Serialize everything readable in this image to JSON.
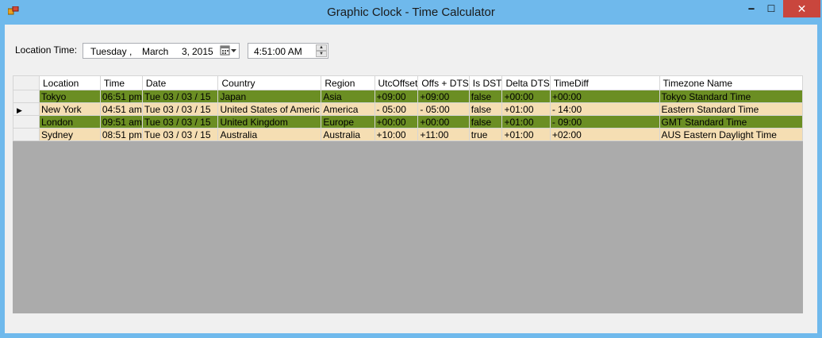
{
  "window": {
    "title": "Graphic Clock - Time Calculator",
    "minimize_glyph": "🗕",
    "maximize_glyph": "☐",
    "close_glyph": "✕"
  },
  "location_time": {
    "label": "Location Time:",
    "date": {
      "weekday": "Tuesday",
      "comma": ",",
      "month": "March",
      "day": "3,",
      "year": "2015"
    },
    "time": "4:51:00 AM"
  },
  "grid": {
    "columns": [
      "Location",
      "Time",
      "Date",
      "Country",
      "Region",
      "UtcOffset",
      "Offs + DTS",
      "Is DST",
      "Delta DTS",
      "TimeDiff",
      "Timezone Name"
    ],
    "rows": [
      {
        "style": "green",
        "selected": false,
        "cells": [
          "Tokyo",
          "06:51 pm",
          "Tue  03 / 03 / 15",
          "Japan",
          "Asia",
          "+09:00",
          "+09:00",
          "false",
          "+00:00",
          "+00:00",
          "Tokyo Standard Time"
        ]
      },
      {
        "style": "tan",
        "selected": true,
        "cells": [
          "New York",
          "04:51 am",
          "Tue  03 / 03 / 15",
          "United States of Americ",
          "America",
          "- 05:00",
          "- 05:00",
          "false",
          "+01:00",
          "- 14:00",
          "Eastern Standard Time"
        ]
      },
      {
        "style": "green",
        "selected": false,
        "cells": [
          "London",
          "09:51 am",
          "Tue  03 / 03 / 15",
          "United Kingdom",
          "Europe",
          "+00:00",
          "+00:00",
          "false",
          "+01:00",
          "- 09:00",
          "GMT Standard Time"
        ]
      },
      {
        "style": "tan",
        "selected": false,
        "cells": [
          "Sydney",
          "08:51 pm",
          "Tue  03 / 03 / 15",
          "Australia",
          "Australia",
          "+10:00",
          "+11:00",
          "true",
          "+01:00",
          "+02:00",
          "AUS Eastern Daylight Time"
        ]
      }
    ]
  },
  "colors": {
    "titlebar": "#6fb9ec",
    "row_green": "#6b8e23",
    "row_tan": "#f5deb3",
    "grid_background": "#ababab"
  }
}
